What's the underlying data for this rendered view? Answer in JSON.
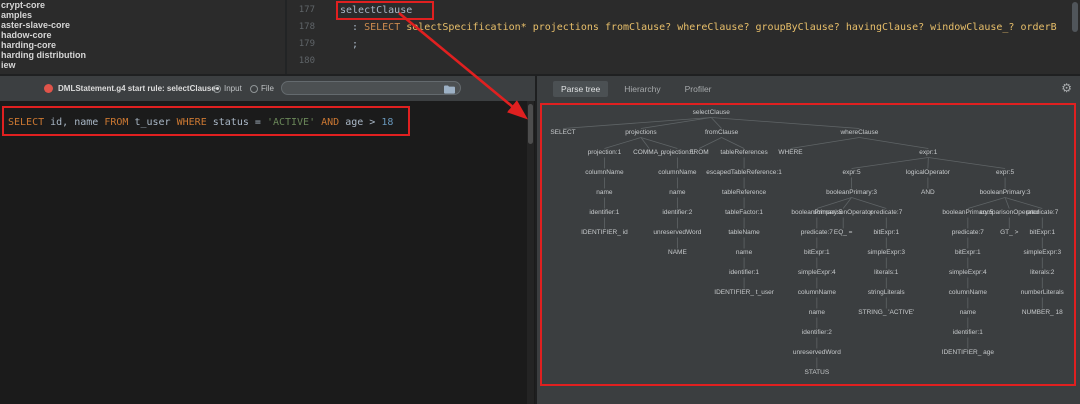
{
  "colors": {
    "annotation_red": "#e02020",
    "start_rule_badge": "#e0544a",
    "keyword_orange": "#cc7832",
    "rule_ref_yellow": "#e8bf6a",
    "string_green": "#6a8759",
    "number_blue": "#6897bb"
  },
  "icons": {
    "settings_gear": "⚙",
    "start_rule_badge": "circle",
    "file_chooser_folder": "folder"
  },
  "project_panel": {
    "items": [
      {
        "label": "crypt-core"
      },
      {
        "label": "amples"
      },
      {
        "label": "aster-slave-core"
      },
      {
        "label": "hadow-core"
      },
      {
        "label": "harding-core"
      },
      {
        "label": "harding distribution"
      },
      {
        "label": "iew"
      }
    ]
  },
  "editor": {
    "lines": [
      {
        "number": "177",
        "segments": [
          {
            "text": "selectClause",
            "color": "#a9b7c6"
          }
        ]
      },
      {
        "number": "178",
        "segments": [
          {
            "text": "  : ",
            "color": "#a9b7c6"
          },
          {
            "text": "SELECT",
            "color": "#cc8b4f"
          },
          {
            "text": " ",
            "color": "#a9b7c6"
          },
          {
            "text": "selectSpecification*",
            "color": "#e8bf6a"
          },
          {
            "text": " ",
            "color": "#a9b7c6"
          },
          {
            "text": "projections",
            "color": "#e8bf6a"
          },
          {
            "text": " ",
            "color": "#a9b7c6"
          },
          {
            "text": "fromClause?",
            "color": "#e8bf6a"
          },
          {
            "text": " ",
            "color": "#a9b7c6"
          },
          {
            "text": "whereClause?",
            "color": "#e8bf6a"
          },
          {
            "text": " ",
            "color": "#a9b7c6"
          },
          {
            "text": "groupByClause?",
            "color": "#e8bf6a"
          },
          {
            "text": " ",
            "color": "#a9b7c6"
          },
          {
            "text": "havingClause?",
            "color": "#e8bf6a"
          },
          {
            "text": " ",
            "color": "#a9b7c6"
          },
          {
            "text": "windowClause_?",
            "color": "#e8bf6a"
          },
          {
            "text": " ",
            "color": "#a9b7c6"
          },
          {
            "text": "orderB",
            "color": "#e8bf6a"
          }
        ]
      },
      {
        "number": "179",
        "segments": [
          {
            "text": "  ;",
            "color": "#a9b7c6"
          }
        ]
      },
      {
        "number": "180",
        "segments": []
      }
    ]
  },
  "preview_panel": {
    "title": "DMLStatement.g4 start rule: selectClause",
    "radios": [
      {
        "label": "Input",
        "selected": true
      },
      {
        "label": "File",
        "selected": false
      }
    ],
    "file_field_value": "",
    "sql_segments": [
      {
        "text": "SELECT",
        "color": "#cc7832"
      },
      {
        "text": " id, name ",
        "color": "#a9b7c6"
      },
      {
        "text": "FROM",
        "color": "#cc7832"
      },
      {
        "text": " t_user ",
        "color": "#a9b7c6"
      },
      {
        "text": "WHERE",
        "color": "#cc7832"
      },
      {
        "text": " status = ",
        "color": "#a9b7c6"
      },
      {
        "text": "'ACTIVE'",
        "color": "#6a8759"
      },
      {
        "text": " ",
        "color": "#a9b7c6"
      },
      {
        "text": "AND",
        "color": "#cc7832"
      },
      {
        "text": " age > ",
        "color": "#a9b7c6"
      },
      {
        "text": "18",
        "color": "#6897bb"
      }
    ]
  },
  "tree_panel": {
    "tabs": [
      {
        "label": "Parse tree",
        "selected": true
      },
      {
        "label": "Hierarchy",
        "selected": false
      },
      {
        "label": "Profiler",
        "selected": false
      }
    ],
    "parse_tree": {
      "label": "selectClause",
      "children": [
        {
          "label": "SELECT"
        },
        {
          "label": "projections",
          "children": [
            {
              "label": "projection:1",
              "children": [
                {
                  "label": "columnName",
                  "children": [
                    {
                      "label": "name",
                      "children": [
                        {
                          "label": "identifier:1",
                          "children": [
                            {
                              "label": "IDENTIFIER_ id"
                            }
                          ]
                        }
                      ]
                    }
                  ]
                }
              ]
            },
            {
              "label": "COMMA_ ,"
            },
            {
              "label": "projection:1",
              "children": [
                {
                  "label": "columnName",
                  "children": [
                    {
                      "label": "name",
                      "children": [
                        {
                          "label": "identifier:2",
                          "children": [
                            {
                              "label": "unreservedWord",
                              "children": [
                                {
                                  "label": "NAME"
                                }
                              ]
                            }
                          ]
                        }
                      ]
                    }
                  ]
                }
              ]
            }
          ]
        },
        {
          "label": "fromClause",
          "children": [
            {
              "label": "FROM"
            },
            {
              "label": "tableReferences",
              "children": [
                {
                  "label": "escapedTableReference:1",
                  "children": [
                    {
                      "label": "tableReference",
                      "children": [
                        {
                          "label": "tableFactor:1",
                          "children": [
                            {
                              "label": "tableName",
                              "children": [
                                {
                                  "label": "name",
                                  "children": [
                                    {
                                      "label": "identifier:1",
                                      "children": [
                                        {
                                          "label": "IDENTIFIER_ t_user"
                                        }
                                      ]
                                    }
                                  ]
                                }
                              ]
                            }
                          ]
                        }
                      ]
                    }
                  ]
                }
              ]
            }
          ]
        },
        {
          "label": "whereClause",
          "children": [
            {
              "label": "WHERE"
            },
            {
              "label": "expr:1",
              "children": [
                {
                  "label": "expr:5",
                  "children": [
                    {
                      "label": "booleanPrimary:3",
                      "children": [
                        {
                          "label": "booleanPrimary:5",
                          "children": [
                            {
                              "label": "predicate:7",
                              "children": [
                                {
                                  "label": "bitExpr:1",
                                  "children": [
                                    {
                                      "label": "simpleExpr:4",
                                      "children": [
                                        {
                                          "label": "columnName",
                                          "children": [
                                            {
                                              "label": "name",
                                              "children": [
                                                {
                                                  "label": "identifier:2",
                                                  "children": [
                                                    {
                                                      "label": "unreservedWord",
                                                      "children": [
                                                        {
                                                          "label": "STATUS"
                                                        }
                                                      ]
                                                    }
                                                  ]
                                                }
                                              ]
                                            }
                                          ]
                                        }
                                      ]
                                    }
                                  ]
                                }
                              ]
                            }
                          ]
                        },
                        {
                          "label": "comparisonOperator",
                          "children": [
                            {
                              "label": "EQ_ ="
                            }
                          ]
                        },
                        {
                          "label": "predicate:7",
                          "children": [
                            {
                              "label": "bitExpr:1",
                              "children": [
                                {
                                  "label": "simpleExpr:3",
                                  "children": [
                                    {
                                      "label": "literals:1",
                                      "children": [
                                        {
                                          "label": "stringLiterals",
                                          "children": [
                                            {
                                              "label": "STRING_ 'ACTIVE'"
                                            }
                                          ]
                                        }
                                      ]
                                    }
                                  ]
                                }
                              ]
                            }
                          ]
                        }
                      ]
                    }
                  ]
                },
                {
                  "label": "logicalOperator",
                  "children": [
                    {
                      "label": "AND"
                    }
                  ]
                },
                {
                  "label": "expr:5",
                  "children": [
                    {
                      "label": "booleanPrimary:3",
                      "children": [
                        {
                          "label": "booleanPrimary:5",
                          "children": [
                            {
                              "label": "predicate:7",
                              "children": [
                                {
                                  "label": "bitExpr:1",
                                  "children": [
                                    {
                                      "label": "simpleExpr:4",
                                      "children": [
                                        {
                                          "label": "columnName",
                                          "children": [
                                            {
                                              "label": "name",
                                              "children": [
                                                {
                                                  "label": "identifier:1",
                                                  "children": [
                                                    {
                                                      "label": "IDENTIFIER_ age"
                                                    }
                                                  ]
                                                }
                                              ]
                                            }
                                          ]
                                        }
                                      ]
                                    }
                                  ]
                                }
                              ]
                            }
                          ]
                        },
                        {
                          "label": "comparisonOperator",
                          "children": [
                            {
                              "label": "GT_ >"
                            }
                          ]
                        },
                        {
                          "label": "predicate:7",
                          "children": [
                            {
                              "label": "bitExpr:1",
                              "children": [
                                {
                                  "label": "simpleExpr:3",
                                  "children": [
                                    {
                                      "label": "literals:2",
                                      "children": [
                                        {
                                          "label": "numberLiterals",
                                          "children": [
                                            {
                                              "label": "NUMBER_ 18"
                                            }
                                          ]
                                        }
                                      ]
                                    }
                                  ]
                                }
                              ]
                            }
                          ]
                        }
                      ]
                    }
                  ]
                }
              ]
            }
          ]
        }
      ]
    }
  }
}
